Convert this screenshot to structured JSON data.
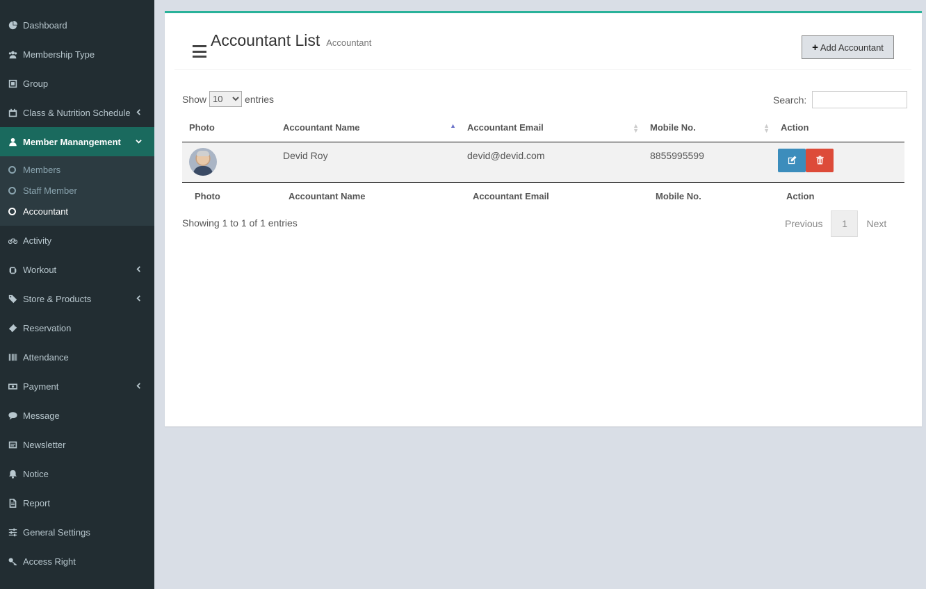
{
  "sidebar": {
    "items": [
      {
        "label": "Dashboard",
        "icon": "dashboard-icon"
      },
      {
        "label": "Membership Type",
        "icon": "users-icon"
      },
      {
        "label": "Group",
        "icon": "group-icon"
      },
      {
        "label": "Class & Nutrition Schedule",
        "icon": "calendar-icon"
      },
      {
        "label": "Member Manangement",
        "icon": "user-icon"
      },
      {
        "label": "Activity",
        "icon": "bicycle-icon"
      },
      {
        "label": "Workout",
        "icon": "hand-icon"
      },
      {
        "label": "Store & Products",
        "icon": "tags-icon"
      },
      {
        "label": "Reservation",
        "icon": "ticket-icon"
      },
      {
        "label": "Attendance",
        "icon": "barcode-icon"
      },
      {
        "label": "Payment",
        "icon": "money-icon"
      },
      {
        "label": "Message",
        "icon": "comment-icon"
      },
      {
        "label": "Newsletter",
        "icon": "envelope-icon"
      },
      {
        "label": "Notice",
        "icon": "bell-icon"
      },
      {
        "label": "Report",
        "icon": "file-icon"
      },
      {
        "label": "General Settings",
        "icon": "sliders-icon"
      },
      {
        "label": "Access Right",
        "icon": "key-icon"
      }
    ],
    "submenu": [
      {
        "label": "Members"
      },
      {
        "label": "Staff Member"
      },
      {
        "label": "Accountant"
      }
    ]
  },
  "header": {
    "title": "Accountant List",
    "subtitle": "Accountant",
    "add_button": "Add Accountant"
  },
  "table_controls": {
    "show_label": "Show",
    "entries_label": "entries",
    "page_size": "10",
    "search_label": "Search:",
    "search_value": ""
  },
  "table": {
    "columns": [
      "Photo",
      "Accountant Name",
      "Accountant Email",
      "Mobile No.",
      "Action"
    ],
    "rows": [
      {
        "name": "Devid Roy",
        "email": "devid@devid.com",
        "mobile": "8855995599"
      }
    ]
  },
  "footer": {
    "info": "Showing 1 to 1 of 1 entries",
    "previous": "Previous",
    "page": "1",
    "next": "Next"
  },
  "colors": {
    "sidebar_bg": "#222d32",
    "active_item_bg": "#1a6a5e",
    "box_top_border": "#2ab29a",
    "edit_button": "#3c8dbc",
    "delete_button": "#dd4b39"
  }
}
